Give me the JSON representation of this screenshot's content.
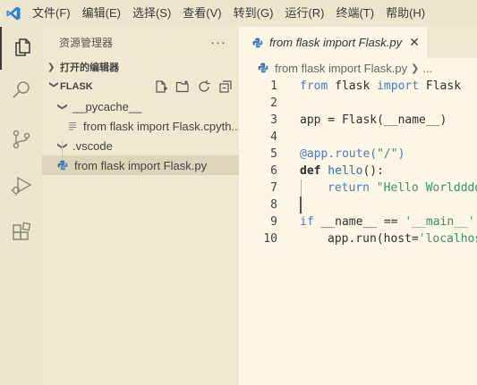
{
  "menu": {
    "items": [
      "文件(F)",
      "编辑(E)",
      "选择(S)",
      "查看(V)",
      "转到(G)",
      "运行(R)",
      "终端(T)",
      "帮助(H)"
    ]
  },
  "icons": {
    "logo": "vscode-logo-icon",
    "explorer": "files-icon",
    "search": "search-icon",
    "scm": "source-control-icon",
    "debug": "run-debug-icon",
    "extensions": "extensions-icon"
  },
  "sidebar": {
    "title": "资源管理器",
    "more": "···",
    "open_editors": "打开的编辑器",
    "folder": "FLASK",
    "tree": [
      {
        "label": "__pycache__",
        "type": "folder",
        "expanded": true
      },
      {
        "label": "from flask import Flask.cpyth...",
        "type": "file"
      },
      {
        "label": ".vscode",
        "type": "folder",
        "expanded": true
      },
      {
        "label": "from flask import Flask.py",
        "type": "python",
        "selected": true
      }
    ]
  },
  "editor": {
    "tab_label": "from flask import Flask.py",
    "breadcrumb_file": "from flask import Flask.py",
    "breadcrumb_more": "...",
    "lines": [
      "1",
      "2",
      "3",
      "4",
      "5",
      "6",
      "7",
      "8",
      "9",
      "10"
    ],
    "code": {
      "l1_kw1": "from",
      "l1_mod": " flask ",
      "l1_kw2": "import",
      "l1_name": " Flask",
      "l3_a": "app = Flask(__name__)",
      "l5_dec": "@app.route(",
      "l5_str": "\"/\"",
      "l5_end": ")",
      "l6_def": "def",
      "l6_fn": " hello",
      "l6_end": "():",
      "l7_ret": "return",
      "l7_str": " \"Hello Worldddd",
      "l9_if": "if",
      "l9_mid": " __name__ == ",
      "l9_str": "'__main__'",
      "l9_end": ":",
      "l10_a": "app.run(host=",
      "l10_str": "'localhos"
    }
  },
  "colors": {
    "accent_blue": "#2e6fb0",
    "background": "#fbf6e6"
  }
}
